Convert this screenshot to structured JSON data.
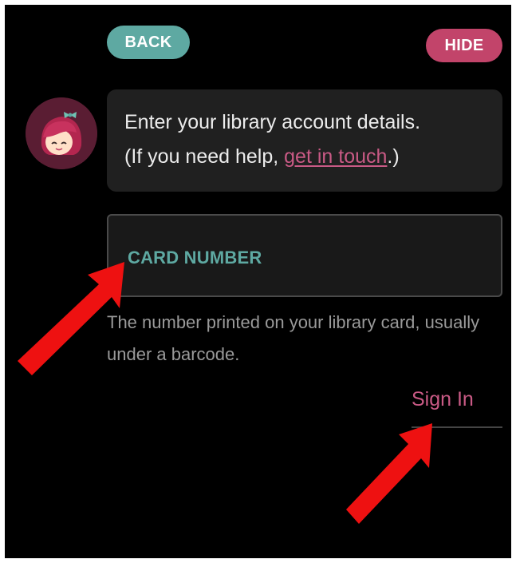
{
  "header": {
    "back_label": "BACK",
    "hide_label": "HIDE"
  },
  "message": {
    "line1": "Enter your library account details.",
    "line2_prefix": "(If you need help, ",
    "link_text": "get in touch",
    "line2_suffix": ".)"
  },
  "card_field": {
    "label": "CARD NUMBER",
    "value": "",
    "hint": "The number printed on your library card, usually under a barcode."
  },
  "signin": {
    "label": "Sign In"
  },
  "colors": {
    "accent_teal": "#5ea9a2",
    "accent_pink": "#c2446a",
    "link_pink": "#c95a85",
    "background": "#000000",
    "annotation_arrow": "#ee1111"
  },
  "icons": {
    "avatar": "librarian-avatar-icon",
    "annotation": "red-arrow-icon"
  }
}
